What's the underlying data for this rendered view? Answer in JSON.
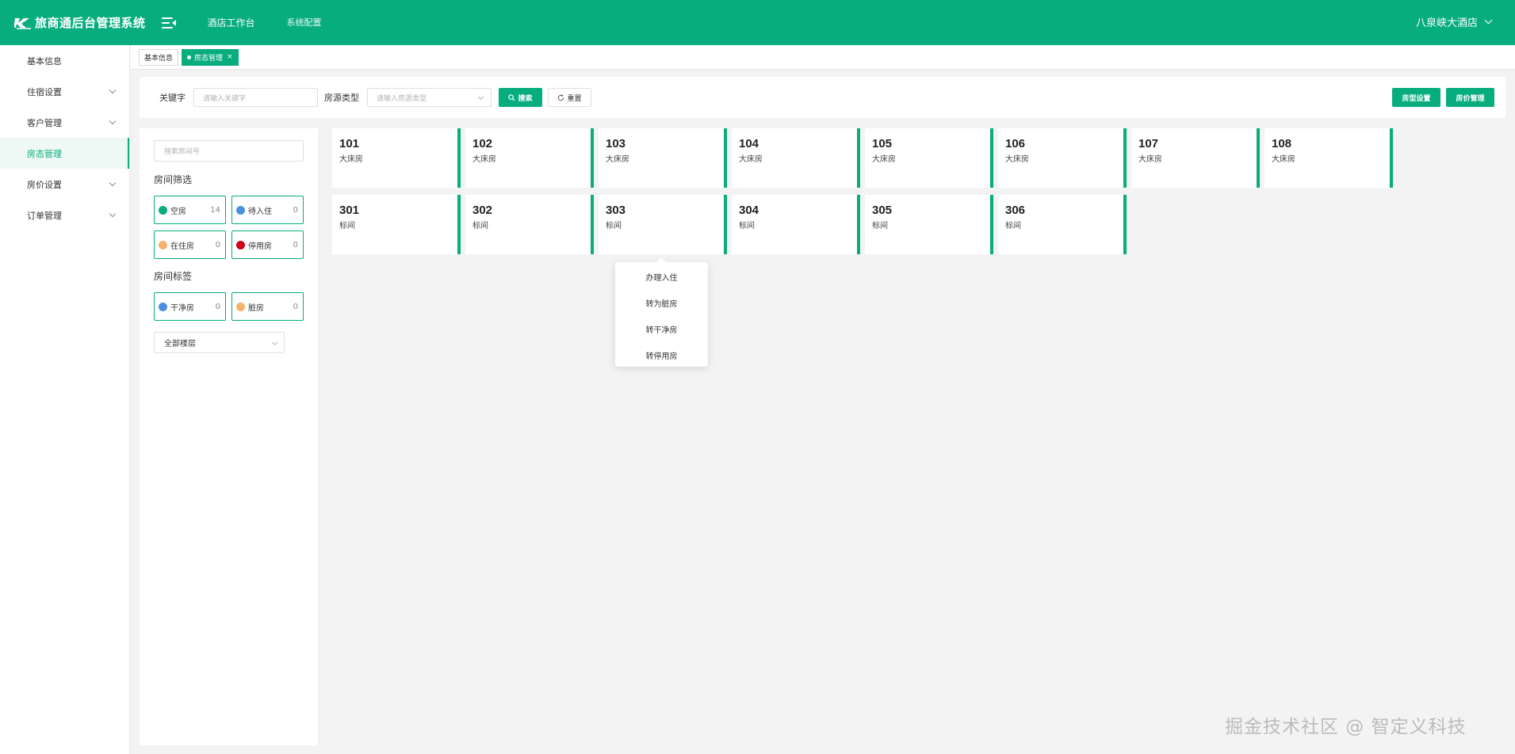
{
  "header": {
    "title": "旅商通后台管理系统",
    "nav": [
      "酒店工作台",
      "系统配置"
    ],
    "hotel_name": "八泉峡大酒店",
    "brand_color": "#07ad7d"
  },
  "sidebar": {
    "items": [
      {
        "label": "基本信息",
        "has_children": false
      },
      {
        "label": "住宿设置",
        "has_children": true
      },
      {
        "label": "客户管理",
        "has_children": true
      },
      {
        "label": "房态管理",
        "has_children": false,
        "active": true
      },
      {
        "label": "房价设置",
        "has_children": true
      },
      {
        "label": "订单管理",
        "has_children": true
      }
    ]
  },
  "tabs": [
    {
      "label": "基本信息",
      "active": false
    },
    {
      "label": "房态管理",
      "active": true,
      "close": "×"
    }
  ],
  "search": {
    "keyword_label": "关键字",
    "keyword_placeholder": "请输入关键字",
    "type_label": "房源类型",
    "type_placeholder": "请输入房源类型",
    "search_button": "搜索",
    "reset_button": "重置",
    "room_type_settings_button": "房型设置",
    "room_price_button": "房价管理"
  },
  "filter": {
    "room_search_placeholder": "搜索房间号",
    "status_title": "房间筛选",
    "statuses": [
      {
        "label": "空房",
        "count": "14",
        "color": "#07ad7d"
      },
      {
        "label": "待入住",
        "count": "0",
        "color": "#4a90e2"
      },
      {
        "label": "在住房",
        "count": "0",
        "color": "#f5b26b"
      },
      {
        "label": "停用房",
        "count": "0",
        "color": "#d0021b"
      }
    ],
    "tag_title": "房间标签",
    "tags": [
      {
        "label": "干净房",
        "count": "0",
        "color": "#4a90e2"
      },
      {
        "label": "脏房",
        "count": "0",
        "color": "#f5b26b"
      }
    ],
    "floor_select": "全部楼层"
  },
  "rooms": [
    {
      "number": "101",
      "type": "大床房"
    },
    {
      "number": "102",
      "type": "大床房"
    },
    {
      "number": "103",
      "type": "大床房"
    },
    {
      "number": "104",
      "type": "大床房"
    },
    {
      "number": "105",
      "type": "大床房"
    },
    {
      "number": "106",
      "type": "大床房"
    },
    {
      "number": "107",
      "type": "大床房"
    },
    {
      "number": "108",
      "type": "大床房"
    },
    {
      "number": "301",
      "type": "标间"
    },
    {
      "number": "302",
      "type": "标间"
    },
    {
      "number": "303",
      "type": "标间"
    },
    {
      "number": "304",
      "type": "标间"
    },
    {
      "number": "305",
      "type": "标间"
    },
    {
      "number": "306",
      "type": "标间"
    }
  ],
  "context_menu": {
    "items": [
      "办理入住",
      "转为脏房",
      "转干净房",
      "转停用房"
    ]
  },
  "watermark": "掘金技术社区 @ 智定义科技"
}
